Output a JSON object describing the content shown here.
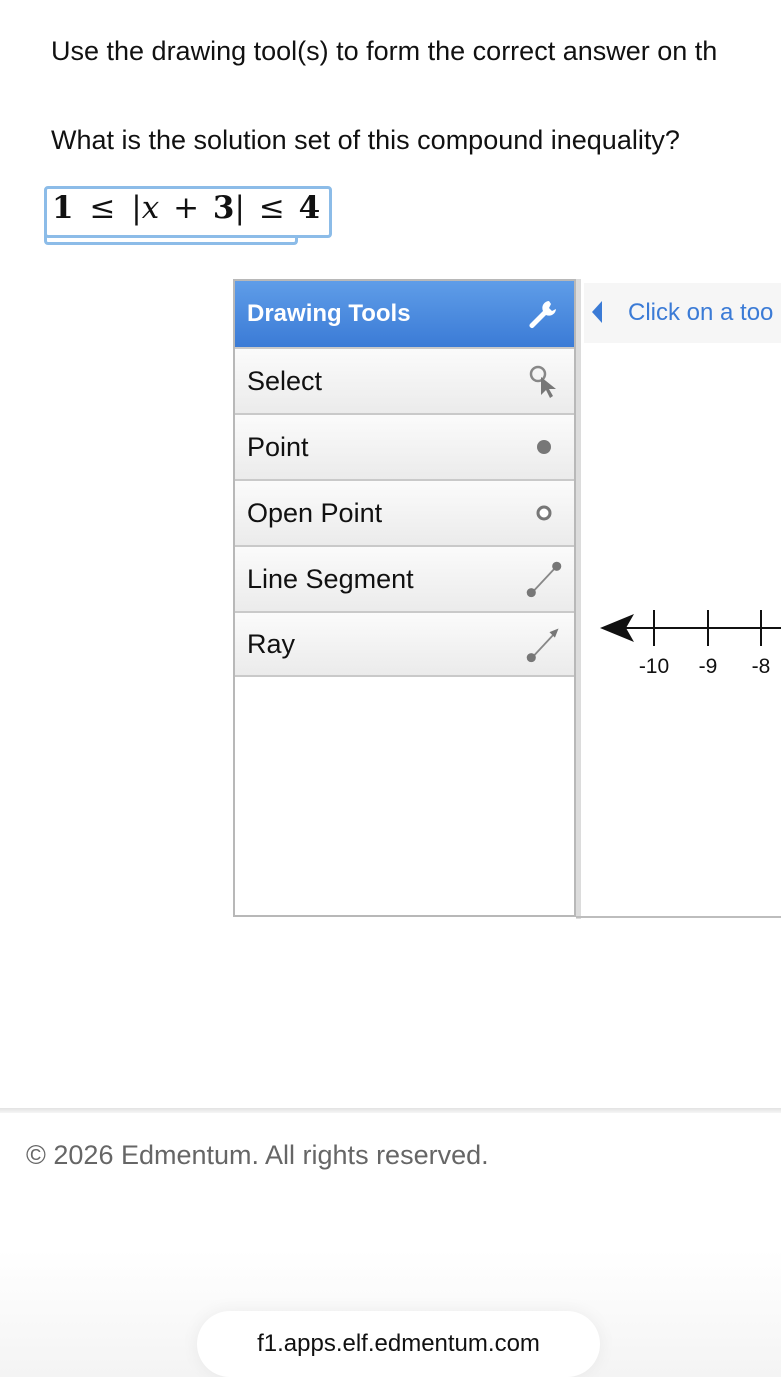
{
  "question": {
    "instruction": "Use the drawing tool(s) to form the correct answer on th",
    "prompt": "What is the solution set of this compound inequality?",
    "math": {
      "left": "1",
      "op1": "≤",
      "abs_open": "|",
      "var": "x",
      "plus": "+",
      "const": "3",
      "abs_close": "|",
      "op2": "≤",
      "right": "4"
    }
  },
  "tools": {
    "header": "Drawing Tools",
    "header_icon": "wrench-icon",
    "items": [
      {
        "label": "Select",
        "icon": "select-cursor-icon"
      },
      {
        "label": "Point",
        "icon": "point-icon"
      },
      {
        "label": "Open Point",
        "icon": "open-point-icon"
      },
      {
        "label": "Line Segment",
        "icon": "line-segment-icon"
      },
      {
        "label": "Ray",
        "icon": "ray-icon"
      }
    ]
  },
  "canvas": {
    "hint": "Click on a too",
    "number_line": {
      "ticks": [
        "-10",
        "-9",
        "-8"
      ]
    }
  },
  "footer": {
    "copyright": "© 2026 Edmentum. All rights reserved.",
    "url": "f1.apps.elf.edmentum.com"
  },
  "colors": {
    "accent": "#3b7bd6",
    "header_blue": "#5f9de8",
    "math_border": "#8cbce8"
  }
}
